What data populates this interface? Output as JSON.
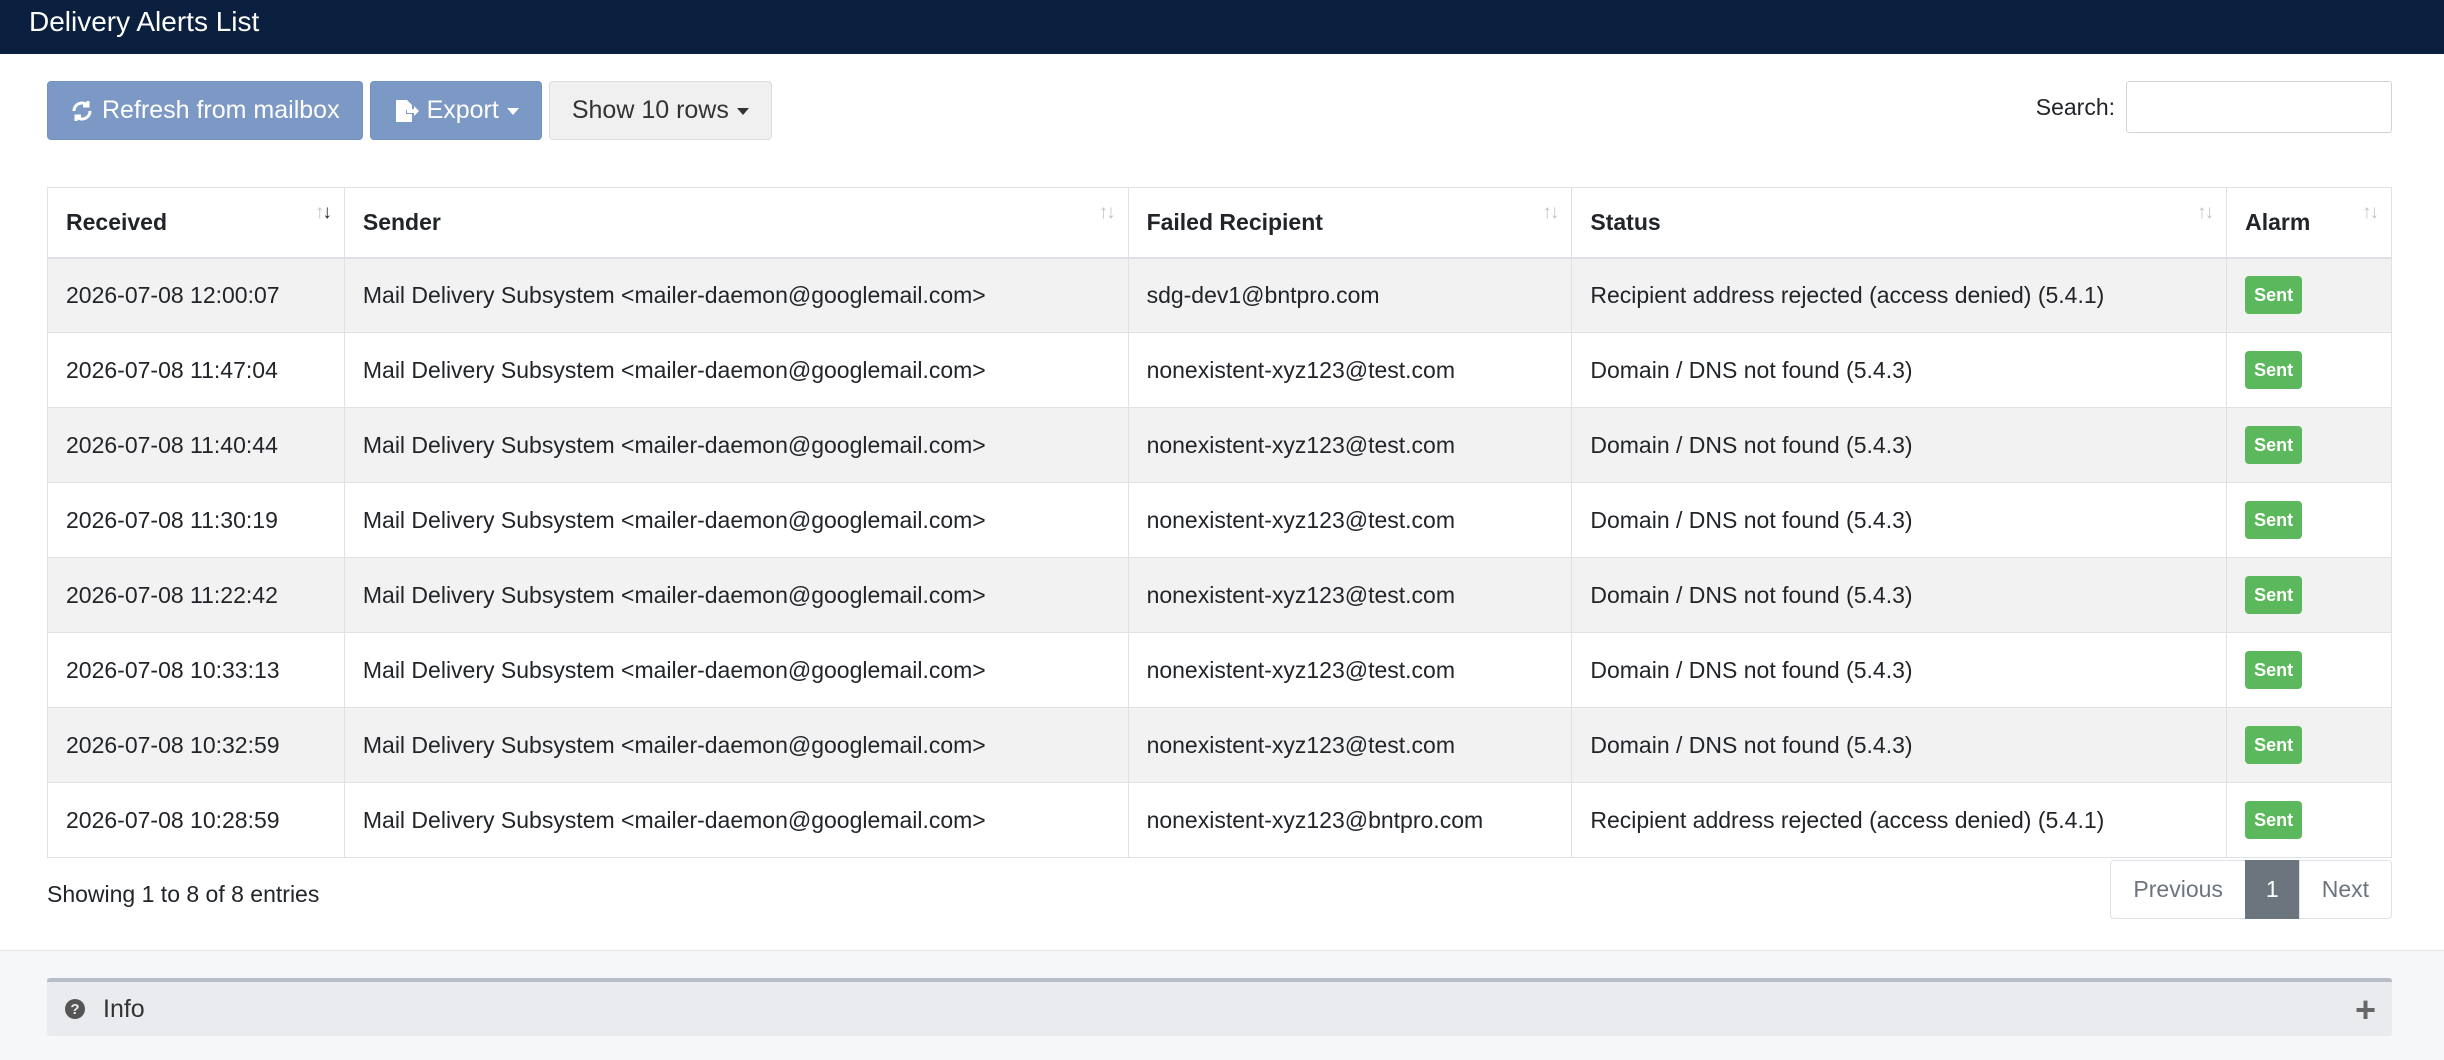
{
  "header": {
    "title": "Delivery Alerts List"
  },
  "toolbar": {
    "refresh_label": "Refresh from mailbox",
    "export_label": "Export",
    "rows_label": "Show 10 rows"
  },
  "search": {
    "label": "Search:",
    "value": "",
    "placeholder": ""
  },
  "table": {
    "columns": [
      "Received",
      "Sender",
      "Failed Recipient",
      "Status",
      "Alarm"
    ],
    "rows": [
      {
        "received": "2026-07-08 12:00:07",
        "sender": "Mail Delivery Subsystem <mailer-daemon@googlemail.com>",
        "recipient": "sdg-dev1@bntpro.com",
        "status": "Recipient address rejected (access denied) (5.4.1)",
        "alarm": "Sent"
      },
      {
        "received": "2026-07-08 11:47:04",
        "sender": "Mail Delivery Subsystem <mailer-daemon@googlemail.com>",
        "recipient": "nonexistent-xyz123@test.com",
        "status": "Domain / DNS not found (5.4.3)",
        "alarm": "Sent"
      },
      {
        "received": "2026-07-08 11:40:44",
        "sender": "Mail Delivery Subsystem <mailer-daemon@googlemail.com>",
        "recipient": "nonexistent-xyz123@test.com",
        "status": "Domain / DNS not found (5.4.3)",
        "alarm": "Sent"
      },
      {
        "received": "2026-07-08 11:30:19",
        "sender": "Mail Delivery Subsystem <mailer-daemon@googlemail.com>",
        "recipient": "nonexistent-xyz123@test.com",
        "status": "Domain / DNS not found (5.4.3)",
        "alarm": "Sent"
      },
      {
        "received": "2026-07-08 11:22:42",
        "sender": "Mail Delivery Subsystem <mailer-daemon@googlemail.com>",
        "recipient": "nonexistent-xyz123@test.com",
        "status": "Domain / DNS not found (5.4.3)",
        "alarm": "Sent"
      },
      {
        "received": "2026-07-08 10:33:13",
        "sender": "Mail Delivery Subsystem <mailer-daemon@googlemail.com>",
        "recipient": "nonexistent-xyz123@test.com",
        "status": "Domain / DNS not found (5.4.3)",
        "alarm": "Sent"
      },
      {
        "received": "2026-07-08 10:32:59",
        "sender": "Mail Delivery Subsystem <mailer-daemon@googlemail.com>",
        "recipient": "nonexistent-xyz123@test.com",
        "status": "Domain / DNS not found (5.4.3)",
        "alarm": "Sent"
      },
      {
        "received": "2026-07-08 10:28:59",
        "sender": "Mail Delivery Subsystem <mailer-daemon@googlemail.com>",
        "recipient": "nonexistent-xyz123@bntpro.com",
        "status": "Recipient address rejected (access denied) (5.4.1)",
        "alarm": "Sent"
      }
    ]
  },
  "footer": {
    "info": "Showing 1 to 8 of 8 entries"
  },
  "pagination": {
    "previous": "Previous",
    "current": "1",
    "next": "Next"
  },
  "info_panel": {
    "title": "Info",
    "expand_symbol": "+"
  },
  "icons": {
    "refresh": "refresh-icon",
    "export": "file-export-icon",
    "sort": "sort-arrows-icon",
    "help": "question-circle-icon",
    "expand": "plus-icon"
  },
  "colors": {
    "topbar": "#0b1f3f",
    "primary_button": "#7c99c6",
    "sent_badge": "#5cb85c",
    "active_page": "#6c757d"
  }
}
